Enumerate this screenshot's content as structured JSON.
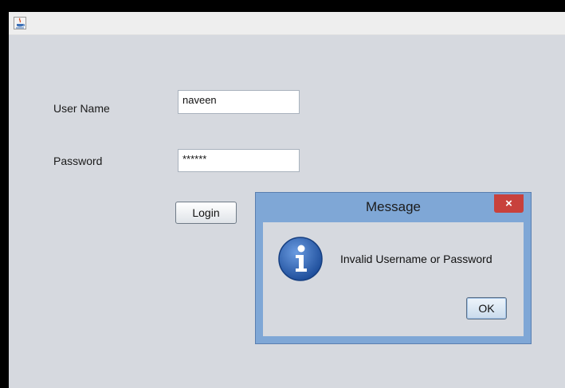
{
  "window": {
    "icon": "java-coffee-cup-icon"
  },
  "form": {
    "username_label": "User Name",
    "username_value": "naveen",
    "password_label": "Password",
    "password_value": "******",
    "login_label": "Login"
  },
  "dialog": {
    "title": "Message",
    "close_symbol": "×",
    "icon": "info-icon",
    "message": "Invalid Username or Password",
    "ok_label": "OK"
  },
  "colors": {
    "window_bg": "#d6d9df",
    "dialog_frame": "#7fa7d6",
    "close_button": "#c8413c",
    "info_icon": "#2f63b4"
  }
}
